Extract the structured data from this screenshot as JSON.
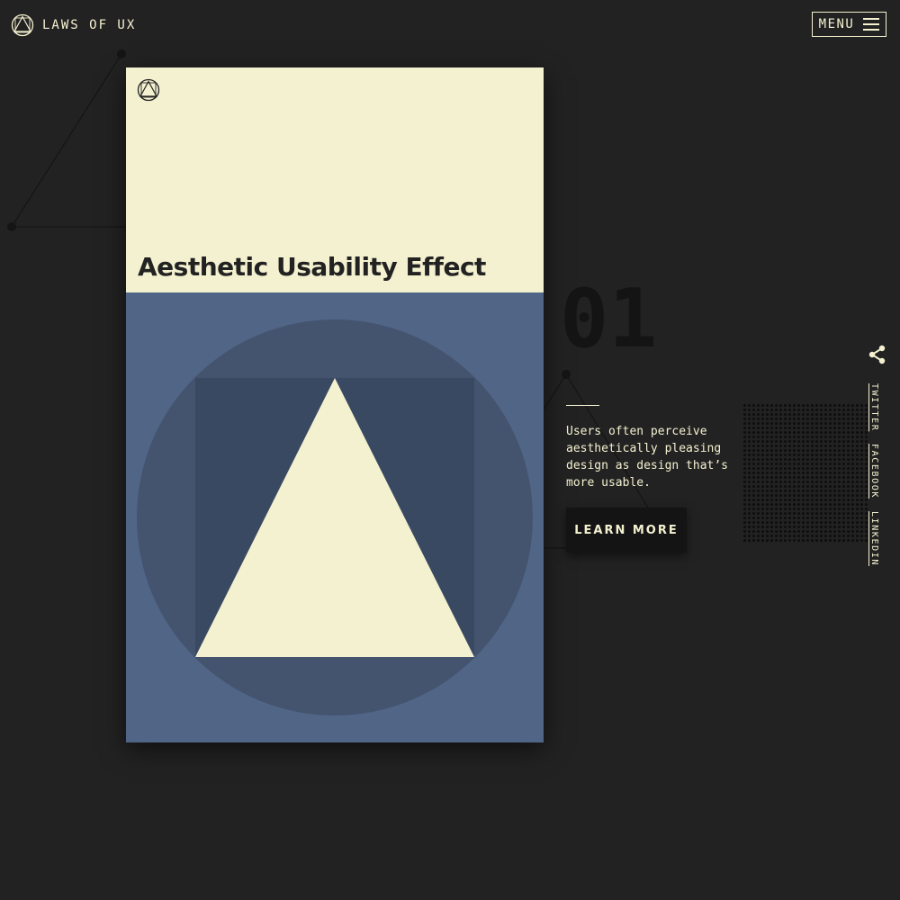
{
  "header": {
    "brand": "LAWS OF UX",
    "brand_icon": "laws-of-ux-logo-icon",
    "menu_label": "MENU",
    "menu_icon": "hamburger-icon"
  },
  "card": {
    "title": "Aesthetic Usability Effect",
    "logo_icon": "laws-of-ux-logo-icon",
    "top_color": "#f4f1d0",
    "bottom_color": "#516587"
  },
  "law": {
    "number": "01",
    "description": "Users often perceive aesthetically pleasing design as design that’s more usable.",
    "cta_label": "LEARN MORE"
  },
  "share": {
    "icon": "share-icon",
    "links": [
      "TWITTER",
      "FACEBOOK",
      "LINKEDIN"
    ]
  },
  "colors": {
    "background": "#222222",
    "cream": "#f4f1d0",
    "blue": "#516587",
    "dark": "#141414"
  }
}
